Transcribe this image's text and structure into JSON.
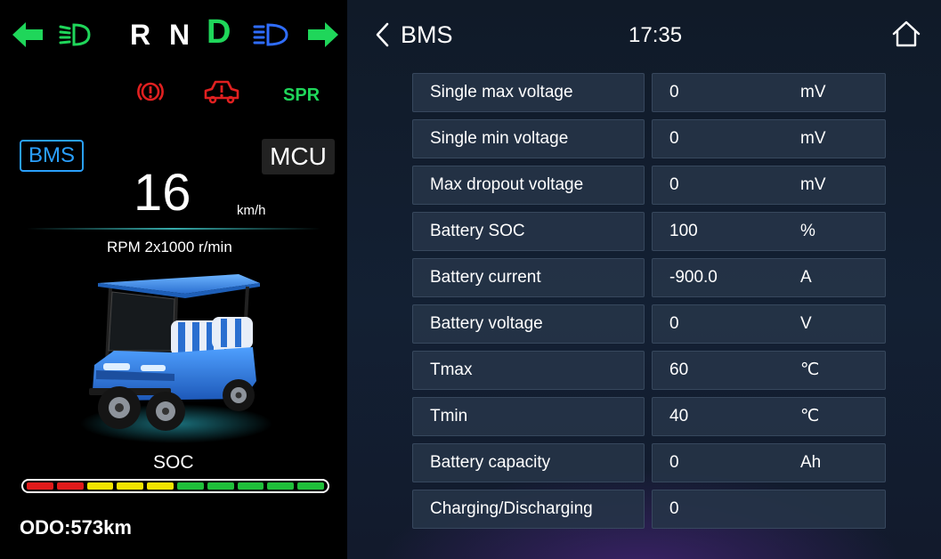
{
  "left_panel": {
    "gears": [
      "R",
      "N",
      "D"
    ],
    "spr_label": "SPR",
    "bms_label": "BMS",
    "mcu_label": "MCU",
    "speed_value": "16",
    "speed_unit": "km/h",
    "rpm_text": "RPM 2x1000 r/min",
    "soc_label": "SOC",
    "soc_segments": [
      "red",
      "red",
      "yellow",
      "yellow",
      "yellow",
      "green",
      "green",
      "green",
      "green",
      "green"
    ],
    "odo_text": "ODO:573km",
    "icons": [
      "left-turn-arrow-icon",
      "low-beam-icon",
      "high-beam-icon",
      "right-turn-arrow-icon",
      "brake-warning-icon",
      "vehicle-fault-icon",
      "golf-cart-image"
    ]
  },
  "header": {
    "title": "BMS",
    "time": "17:35"
  },
  "table": {
    "rows": [
      {
        "label": "Single max voltage",
        "value": "0",
        "unit": "mV"
      },
      {
        "label": "Single min voltage",
        "value": "0",
        "unit": "mV"
      },
      {
        "label": "Max dropout voltage",
        "value": "0",
        "unit": "mV"
      },
      {
        "label": "Battery SOC",
        "value": "100",
        "unit": "%"
      },
      {
        "label": "Battery current",
        "value": "-900.0",
        "unit": "A"
      },
      {
        "label": "Battery voltage",
        "value": "0",
        "unit": "V"
      },
      {
        "label": "Tmax",
        "value": "60",
        "unit": "℃"
      },
      {
        "label": "Tmin",
        "value": "40",
        "unit": "℃"
      },
      {
        "label": "Battery capacity",
        "value": "0",
        "unit": "Ah"
      },
      {
        "label": "Charging/Discharging",
        "value": "0",
        "unit": ""
      }
    ]
  },
  "colors": {
    "turn_green": "#1fd65a",
    "high_beam_blue": "#2f6dff",
    "warning_red": "#e02020",
    "bms_accent": "#2aa0ff",
    "soc_red": "#e01a1a",
    "soc_yellow": "#f2e400",
    "soc_green": "#1fbf3a"
  }
}
